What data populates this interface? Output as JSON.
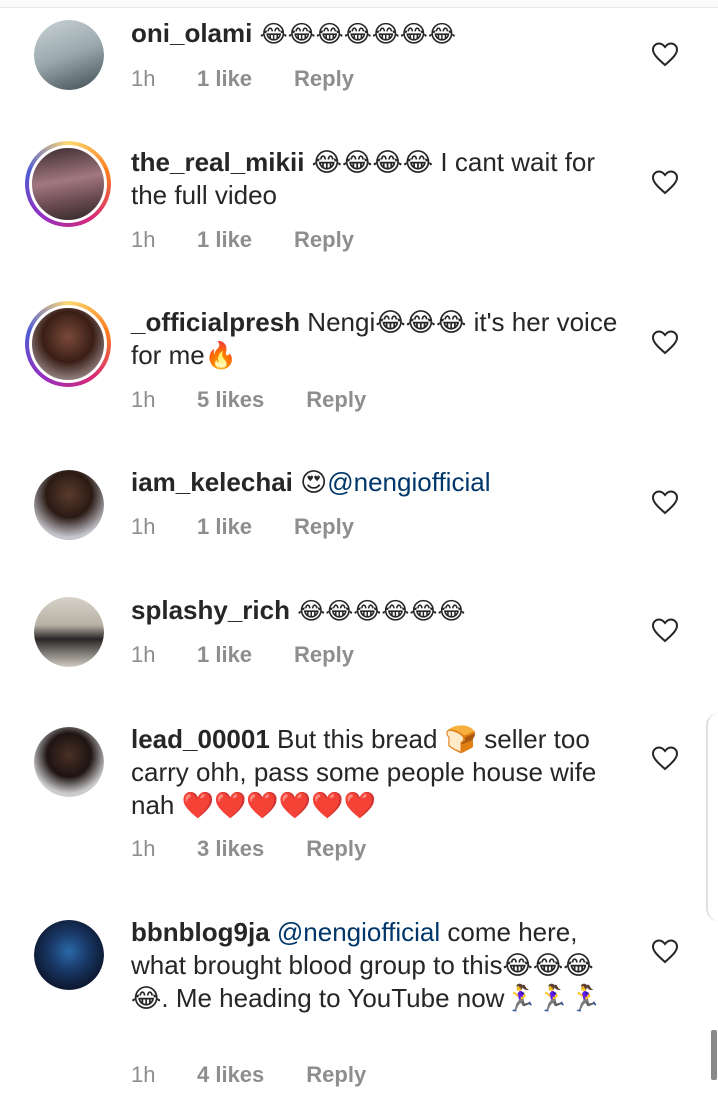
{
  "comments": [
    {
      "username": "oni_olami",
      "text": "😂😂😂😂😂😂😂",
      "time": "1h",
      "likes": "1 like",
      "reply": "Reply",
      "avatar_icon": "user-avatar-icon",
      "story_ring": false
    },
    {
      "username": "the_real_mikii",
      "text": "😂😂😂😂 I cant wait for the full video",
      "time": "1h",
      "likes": "1 like",
      "reply": "Reply",
      "avatar_icon": "user-avatar-icon",
      "story_ring": true
    },
    {
      "username": "_officialpresh",
      "text": "Nengi😂😂😂 it's her voice for me🔥",
      "time": "1h",
      "likes": "5 likes",
      "reply": "Reply",
      "avatar_icon": "user-avatar-icon",
      "story_ring": true
    },
    {
      "username": "iam_kelechai",
      "text": "😍",
      "mention": "@nengiofficial",
      "time": "1h",
      "likes": "1 like",
      "reply": "Reply",
      "avatar_icon": "user-avatar-icon",
      "story_ring": false
    },
    {
      "username": "splashy_rich",
      "text": "😂😂😂😂😂😂",
      "time": "1h",
      "likes": "1 like",
      "reply": "Reply",
      "avatar_icon": "user-avatar-icon",
      "story_ring": false
    },
    {
      "username": "lead_00001",
      "text": "But this bread 🍞 seller too carry ohh, pass some people house wife nah ❤️❤️❤️❤️❤️❤️",
      "time": "1h",
      "likes": "3 likes",
      "reply": "Reply",
      "avatar_icon": "user-avatar-icon",
      "story_ring": false
    },
    {
      "username": "bbnblog9ja",
      "mention": "@nengiofficial",
      "text": "come here, what brought blood group to this😂😂😂😂. Me heading to YouTube now🏃‍♀️🏃‍♀️🏃‍♀️",
      "time": "1h",
      "likes": "4 likes",
      "reply": "Reply",
      "avatar_icon": "user-avatar-icon",
      "story_ring": false
    }
  ],
  "colors": {
    "username": "#262626",
    "mention": "#00376b",
    "meta": "#8e8e8e",
    "story_ring": "#d62976"
  },
  "icons": {
    "like": "heart-outline-icon"
  }
}
